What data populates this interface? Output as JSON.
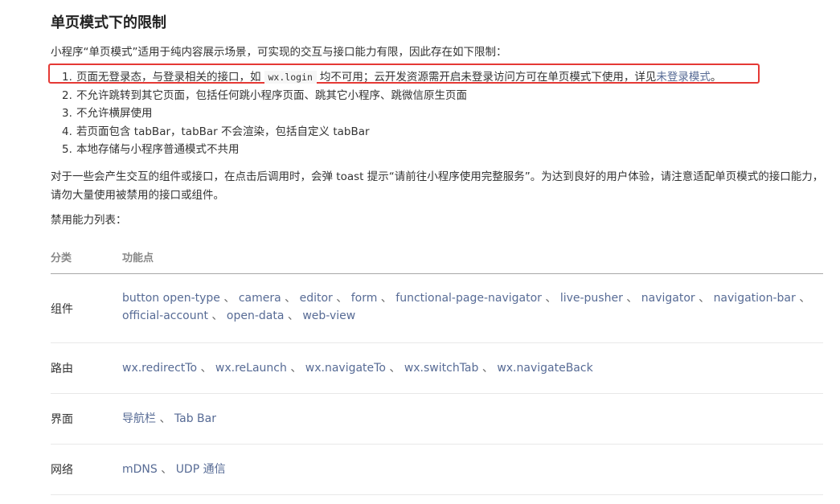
{
  "title": "单页模式下的限制",
  "intro": "小程序“单页模式”适用于纯内容展示场景，可实现的交互与接口能力有限，因此存在如下限制：",
  "limits": [
    {
      "num": "1.",
      "before": "页面无登录态，与登录相关的接口，如",
      "code": "wx.login",
      "after": "均不可用；云开发资源需开启未登录访问方可在单页模式下使用，详见",
      "link": "未登录模式",
      "end": "。"
    },
    {
      "num": "2.",
      "text": "不允许跳转到其它页面，包括任何跳小程序页面、跳其它小程序、跳微信原生页面"
    },
    {
      "num": "3.",
      "text": "不允许横屏使用"
    },
    {
      "num": "4.",
      "text": "若页面包含 tabBar，tabBar 不会渲染，包括自定义 tabBar"
    },
    {
      "num": "5.",
      "text": "本地存储与小程序普通模式不共用"
    }
  ],
  "para": "对于一些会产生交互的组件或接口，在点击后调用时，会弹 toast 提示“请前往小程序使用完整服务”。为达到良好的用户体验，请注意适配单页模式的接口能力，请勿大量使用被禁用的接口或组件。",
  "list_title": "禁用能力列表：",
  "table": {
    "headers": {
      "category": "分类",
      "features": "功能点"
    },
    "separator": "、",
    "rows": [
      {
        "category": "组件",
        "items": [
          "button open-type",
          "camera",
          "editor",
          "form",
          "functional-page-navigator",
          "live-pusher",
          "navigator",
          "navigation-bar",
          "official-account",
          "open-data",
          "web-view"
        ]
      },
      {
        "category": "路由",
        "items": [
          "wx.redirectTo",
          "wx.reLaunch",
          "wx.navigateTo",
          "wx.switchTab",
          "wx.navigateBack"
        ]
      },
      {
        "category": "界面",
        "items": [
          "导航栏",
          "Tab Bar"
        ]
      },
      {
        "category": "网络",
        "items": [
          "mDNS",
          "UDP 通信"
        ]
      }
    ]
  }
}
